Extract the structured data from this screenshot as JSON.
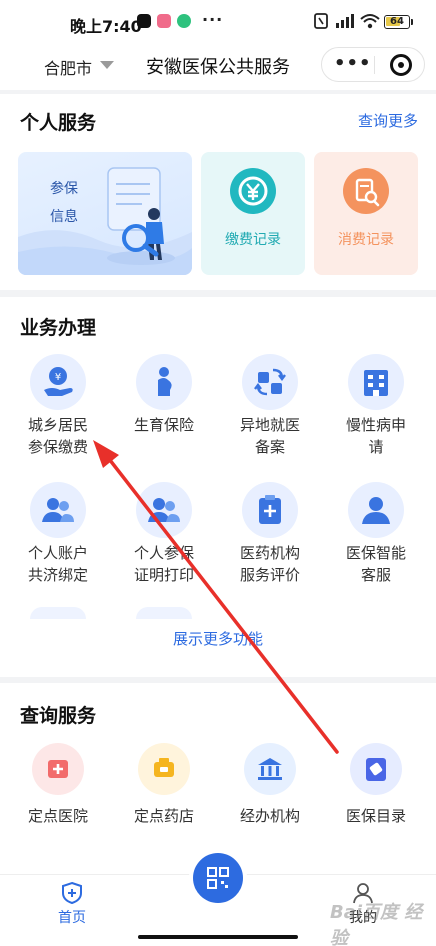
{
  "status_bar": {
    "time": "晚上7:40",
    "battery": "64",
    "dots": "···"
  },
  "nav": {
    "city": "合肥市",
    "title": "安徽医保公共服务",
    "more": "•••"
  },
  "personal": {
    "title": "个人服务",
    "more": "查询更多",
    "main_line1": "参保",
    "main_line2": "信息",
    "pay_label": "缴费记录",
    "consume_label": "消费记录"
  },
  "business": {
    "title": "业务办理",
    "items": [
      {
        "l1": "城乡居民",
        "l2": "参保缴费"
      },
      {
        "l1": "生育保险",
        "l2": ""
      },
      {
        "l1": "异地就医",
        "l2": "备案"
      },
      {
        "l1": "慢性病申",
        "l2": "请"
      },
      {
        "l1": "个人账户",
        "l2": "共济绑定"
      },
      {
        "l1": "个人参保",
        "l2": "证明打印"
      },
      {
        "l1": "医药机构",
        "l2": "服务评价"
      },
      {
        "l1": "医保智能",
        "l2": "客服"
      }
    ],
    "expand": "展示更多功能"
  },
  "query": {
    "title": "查询服务",
    "items": [
      {
        "label": "定点医院"
      },
      {
        "label": "定点药店"
      },
      {
        "label": "经办机构"
      },
      {
        "label": "医保目录"
      }
    ]
  },
  "tabbar": {
    "home": "首页",
    "mine": "我的"
  },
  "watermark": "Bai百度 经验",
  "colors": {
    "accent": "#2d6be0",
    "teal": "#21b8c0",
    "orange": "#f4935e",
    "annotation": "#e8302a"
  }
}
